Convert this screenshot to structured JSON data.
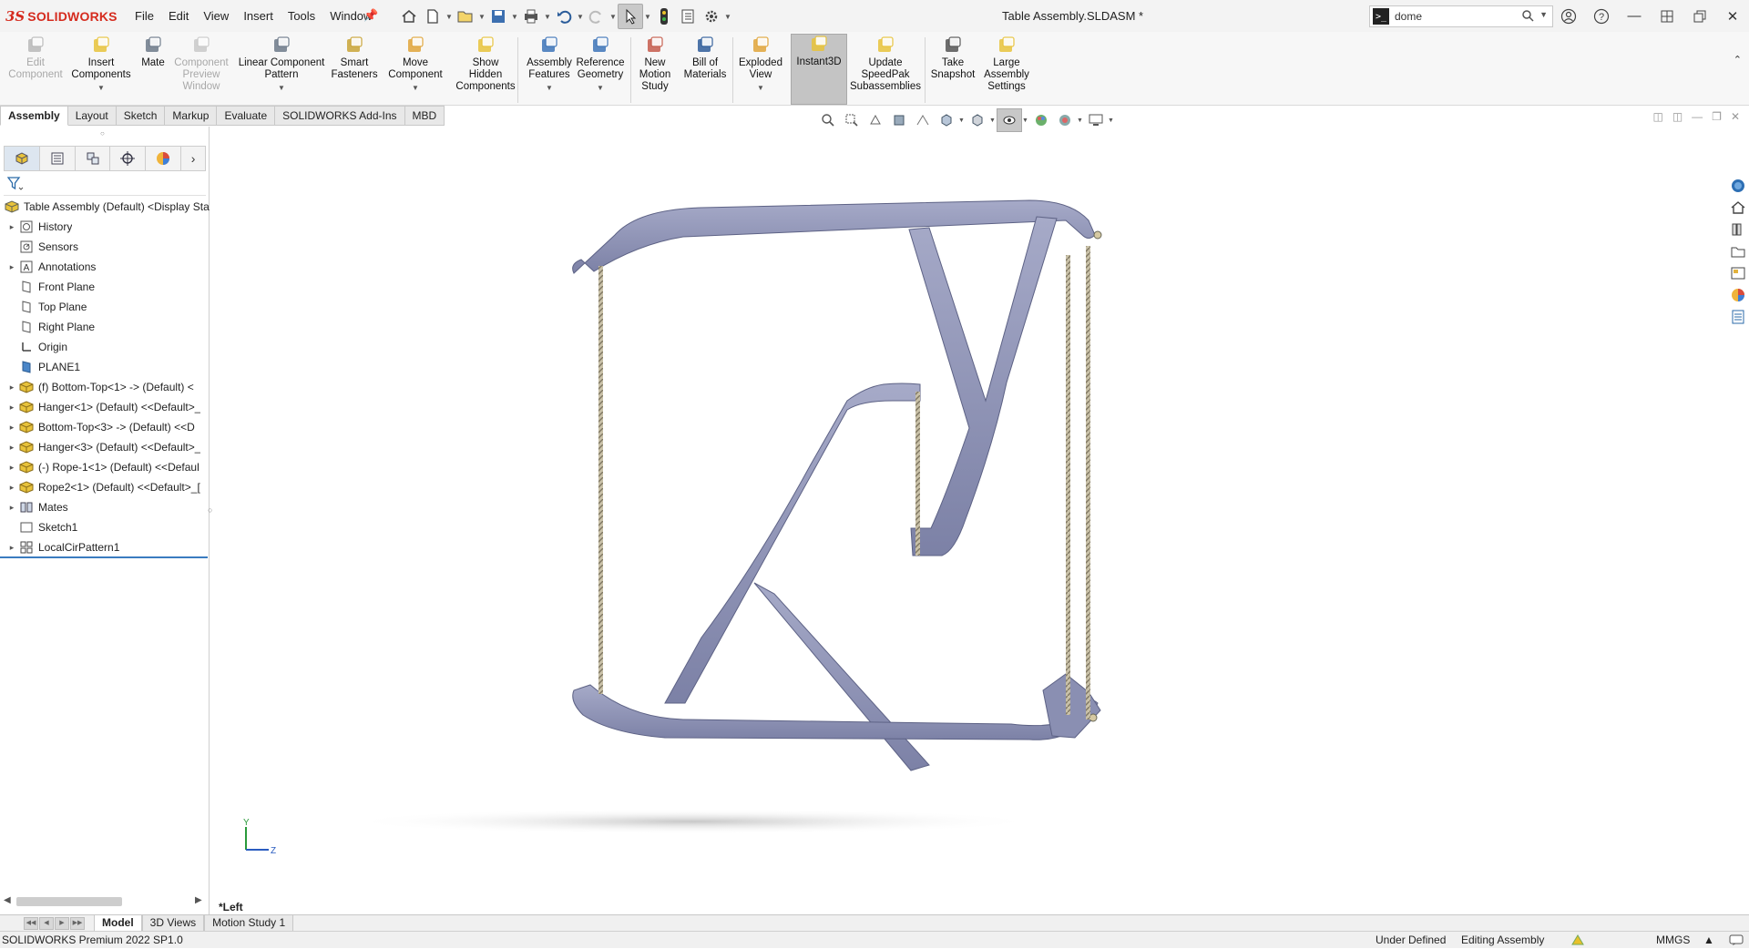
{
  "app": {
    "logo_ds": "3S",
    "logo_name": "SOLIDWORKS",
    "doc_title": "Table Assembly.SLDASM *"
  },
  "menu": [
    "File",
    "Edit",
    "View",
    "Insert",
    "Tools",
    "Window"
  ],
  "search": {
    "value": "dome",
    "placeholder": ""
  },
  "ribbon": [
    {
      "id": "edit-component",
      "label": "Edit\nComponent",
      "disabled": true,
      "drop": false
    },
    {
      "id": "insert-components",
      "label": "Insert\nComponents",
      "disabled": false,
      "drop": true
    },
    {
      "id": "mate",
      "label": "Mate",
      "disabled": false,
      "drop": false
    },
    {
      "id": "component-preview-window",
      "label": "Component\nPreview\nWindow",
      "disabled": true,
      "drop": false
    },
    {
      "id": "linear-component-pattern",
      "label": "Linear Component\nPattern",
      "disabled": false,
      "drop": true
    },
    {
      "id": "smart-fasteners",
      "label": "Smart\nFasteners",
      "disabled": false,
      "drop": false
    },
    {
      "id": "move-component",
      "label": "Move\nComponent",
      "disabled": false,
      "drop": true
    },
    {
      "id": "show-hidden-components",
      "label": "Show\nHidden\nComponents",
      "disabled": false,
      "drop": false
    },
    {
      "id": "assembly-features",
      "label": "Assembly\nFeatures",
      "disabled": false,
      "drop": true
    },
    {
      "id": "reference-geometry",
      "label": "Reference\nGeometry",
      "disabled": false,
      "drop": true
    },
    {
      "id": "new-motion-study",
      "label": "New\nMotion\nStudy",
      "disabled": false,
      "drop": false
    },
    {
      "id": "bill-of-materials",
      "label": "Bill of\nMaterials",
      "disabled": false,
      "drop": false
    },
    {
      "id": "exploded-view",
      "label": "Exploded\nView",
      "disabled": false,
      "drop": true
    },
    {
      "id": "instant3d",
      "label": "Instant3D",
      "disabled": false,
      "drop": false,
      "active": true
    },
    {
      "id": "update-speedpak",
      "label": "Update\nSpeedPak\nSubassemblies",
      "disabled": false,
      "drop": false
    },
    {
      "id": "take-snapshot",
      "label": "Take\nSnapshot",
      "disabled": false,
      "drop": false
    },
    {
      "id": "large-assembly-settings",
      "label": "Large\nAssembly\nSettings",
      "disabled": false,
      "drop": false
    }
  ],
  "cmd_tabs": [
    "Assembly",
    "Layout",
    "Sketch",
    "Markup",
    "Evaluate",
    "SOLIDWORKS Add-Ins",
    "MBD"
  ],
  "tree": [
    {
      "label": "Table Assembly (Default) <Display Sta",
      "icon": "assembly-icon",
      "exp": false,
      "root": true
    },
    {
      "label": "History",
      "icon": "history-icon",
      "exp": true
    },
    {
      "label": "Sensors",
      "icon": "sensors-icon",
      "exp": false
    },
    {
      "label": "Annotations",
      "icon": "annotations-icon",
      "exp": true
    },
    {
      "label": "Front Plane",
      "icon": "plane-icon",
      "exp": false
    },
    {
      "label": "Top Plane",
      "icon": "plane-icon",
      "exp": false
    },
    {
      "label": "Right Plane",
      "icon": "plane-icon",
      "exp": false
    },
    {
      "label": "Origin",
      "icon": "origin-icon",
      "exp": false
    },
    {
      "label": "PLANE1",
      "icon": "plane-blue-icon",
      "exp": false
    },
    {
      "label": "(f) Bottom-Top<1> -> (Default) <",
      "icon": "part-icon",
      "exp": true
    },
    {
      "label": "Hanger<1> (Default) <<Default>_",
      "icon": "part-icon",
      "exp": true
    },
    {
      "label": "Bottom-Top<3> -> (Default) <<D",
      "icon": "part-icon",
      "exp": true
    },
    {
      "label": "Hanger<3> (Default) <<Default>_",
      "icon": "part-icon",
      "exp": true
    },
    {
      "label": "(-) Rope-1<1> (Default) <<Defaul",
      "icon": "part-icon",
      "exp": true
    },
    {
      "label": "Rope2<1> (Default) <<Default>_[",
      "icon": "part-icon",
      "exp": true
    },
    {
      "label": "Mates",
      "icon": "mates-icon",
      "exp": true
    },
    {
      "label": "Sketch1",
      "icon": "sketch-icon",
      "exp": false
    },
    {
      "label": "LocalCirPattern1",
      "icon": "pattern-icon",
      "exp": true
    }
  ],
  "viewport": {
    "orientation_label": "*Left",
    "triad_y": "Y",
    "triad_z": "Z"
  },
  "bottom_tabs": [
    "Model",
    "3D Views",
    "Motion Study 1"
  ],
  "status": {
    "version": "SOLIDWORKS Premium 2022 SP1.0",
    "definition": "Under Defined",
    "mode": "Editing Assembly",
    "units": "MMGS"
  },
  "colors": {
    "brand": "#d52b1e",
    "model": "#8d92b5",
    "rope": "#b8b09a",
    "accent": "#3a7cc0"
  }
}
